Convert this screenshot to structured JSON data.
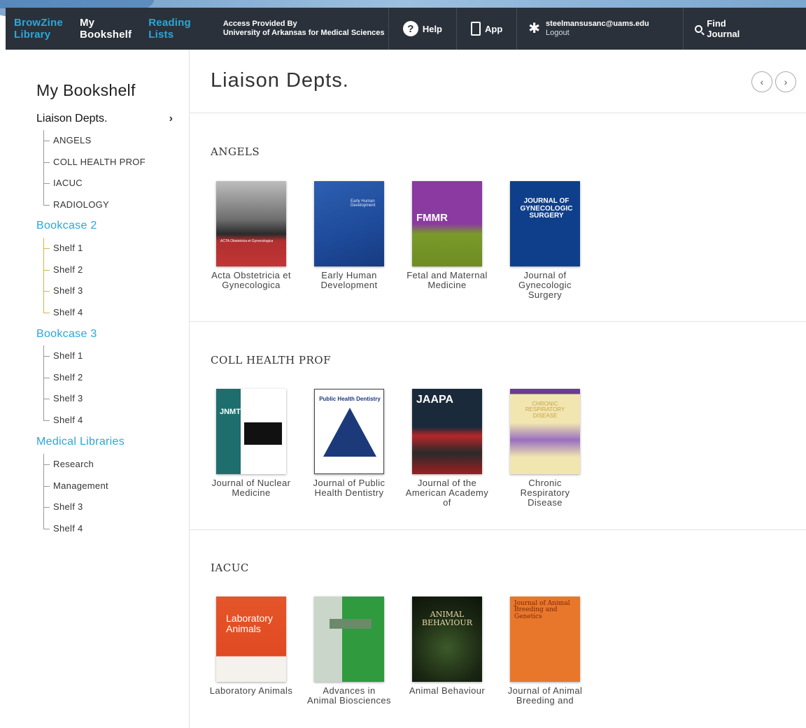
{
  "header": {
    "browzine": [
      "BrowZine",
      "Library"
    ],
    "bookshelf": [
      "My",
      "Bookshelf"
    ],
    "reading": [
      "Reading",
      "Lists"
    ],
    "access_line1": "Access Provided By",
    "access_line2": "University of Arkansas for Medical Sciences",
    "help": "Help",
    "app": "App",
    "email": "steelmansusanc@uams.edu",
    "logout": "Logout",
    "find": [
      "Find",
      "Journal"
    ]
  },
  "sidebar": {
    "title": "My Bookshelf",
    "current": "Liaison Depts.",
    "current_items": [
      "ANGELS",
      "COLL HEALTH PROF",
      "IACUC",
      "RADIOLOGY"
    ],
    "bookcase2": "Bookcase 2",
    "bookcase2_items": [
      "Shelf 1",
      "Shelf 2",
      "Shelf 3",
      "Shelf 4"
    ],
    "bookcase3": "Bookcase 3",
    "bookcase3_items": [
      "Shelf 1",
      "Shelf 2",
      "Shelf 3",
      "Shelf 4"
    ],
    "medlib": "Medical Libraries",
    "medlib_items": [
      "Research",
      "Management",
      "Shelf 3",
      "Shelf 4"
    ]
  },
  "main": {
    "title": "Liaison Depts.",
    "prev": "‹",
    "next": "›",
    "shelves": [
      {
        "name": "ANGELS",
        "journals": [
          {
            "title": "Acta Obstetricia et Gynecologica",
            "cover": "ACTA Obstetricia et Gynecologica"
          },
          {
            "title": "Early Human Development",
            "cover": "Early Human Development"
          },
          {
            "title": "Fetal and Maternal Medicine",
            "cover": "FMMR"
          },
          {
            "title": "Journal of Gynecologic Surgery",
            "cover": "JOURNAL OF GYNECOLOGIC SURGERY"
          }
        ]
      },
      {
        "name": "COLL HEALTH PROF",
        "journals": [
          {
            "title": "Journal of Nuclear Medicine",
            "cover": "JNMT"
          },
          {
            "title": "Journal of Public Health Dentistry",
            "cover": "Public Health Dentistry"
          },
          {
            "title": "Journal of the American Academy of",
            "cover": "JAAPA"
          },
          {
            "title": "Chronic Respiratory Disease",
            "cover": "CHRONIC RESPIRATORY DISEASE"
          }
        ]
      },
      {
        "name": "IACUC",
        "journals": [
          {
            "title": "Laboratory Animals",
            "cover": "Laboratory Animals"
          },
          {
            "title": "Advances in Animal Biosciences",
            "cover": ""
          },
          {
            "title": "Animal Behaviour",
            "cover": "ANIMAL BEHAVIOUR"
          },
          {
            "title": "Journal of Animal Breeding and",
            "cover": "Journal of Animal Breeding and Genetics"
          }
        ]
      }
    ]
  },
  "colors": {
    "header_bg": "#2b313a",
    "accent_blue": "#2aa7d9",
    "tree_gold": "#d9b24a"
  }
}
